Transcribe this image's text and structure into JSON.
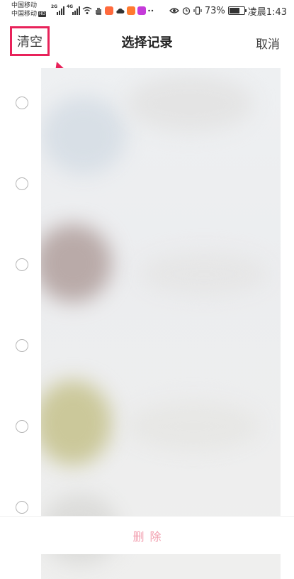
{
  "status_bar": {
    "carrier_1": "中国移动",
    "carrier_2": "中国移动",
    "hd": "HD",
    "net_1": "2G",
    "net_2": "4G",
    "battery": "73%",
    "battery_level": 0.73,
    "time": "凌晨1:43"
  },
  "header": {
    "clear_label": "清空",
    "title": "选择记录",
    "cancel_label": "取消"
  },
  "bottom": {
    "delete_label": "删除"
  },
  "colors": {
    "highlight": "#e8225a",
    "delete_disabled": "#f2a0b0"
  }
}
